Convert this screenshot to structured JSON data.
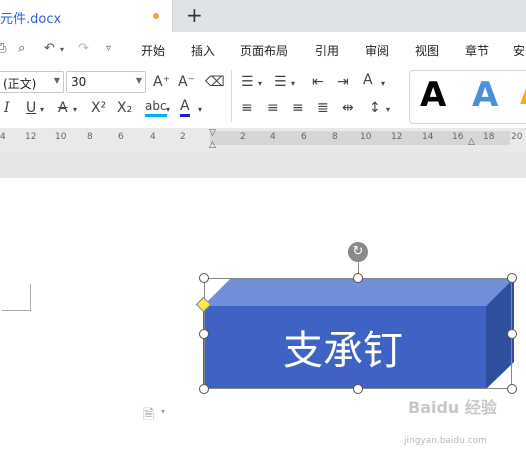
{
  "tab": {
    "title": "元件.docx"
  },
  "quick_access": [
    "print-icon",
    "print-preview-icon",
    "undo-icon",
    "redo-icon",
    "customize-icon"
  ],
  "menu": {
    "tabs": [
      "开始",
      "插入",
      "页面布局",
      "引用",
      "审阅",
      "视图",
      "章节",
      "安"
    ]
  },
  "toolbar": {
    "font_name": "(正文)",
    "font_size": "30",
    "underline_label": "U",
    "italic_label": "I",
    "strike_label": "A",
    "superscript_label": "X²",
    "subscript_label": "X₂",
    "phonetic_label": "abc",
    "font_color_label": "A",
    "grow_font_label": "A⁺",
    "shrink_font_label": "A⁻",
    "clear_format_label": "⌫",
    "style_a1": "A",
    "style_a2": "A",
    "highlight_color": "#00b0f0",
    "font_color": "#1f1fd1"
  },
  "ruler": {
    "labels": [
      "4",
      "12",
      "10",
      "8",
      "6",
      "4",
      "2",
      "2",
      "4",
      "6",
      "8",
      "10",
      "12",
      "14",
      "16",
      "18",
      "20"
    ]
  },
  "shape": {
    "text": "支承钉",
    "fill": "#3e63c4",
    "top_color": "#6f8fd9",
    "side_color": "#2e4f9e"
  },
  "watermark": {
    "text": "Baidu 经验",
    "subtext": "jingyan.baidu.com"
  }
}
